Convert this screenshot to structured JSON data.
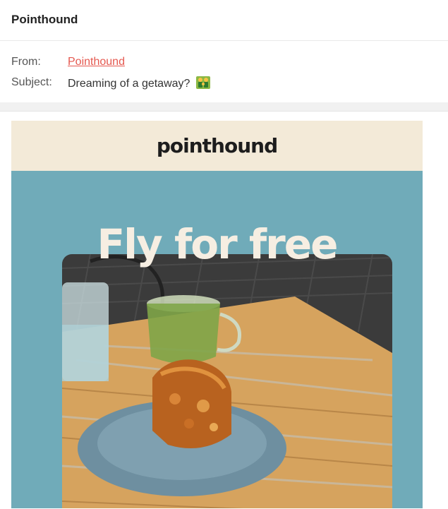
{
  "email": {
    "sender_title": "Pointhound",
    "from_label": "From:",
    "from_value": "Pointhound",
    "subject_label": "Subject:",
    "subject_value": "Dreaming of a getaway?",
    "subject_emoji": "family-emoji-icon"
  },
  "message": {
    "brand_logo": "pointhound",
    "hero_title": "Fly for free",
    "hero_image": "cafe-table-photo",
    "colors": {
      "brand_band": "#f3ead8",
      "hero_background": "#70abb9",
      "hero_title": "#f6eee2",
      "link": "#e5584f"
    }
  }
}
